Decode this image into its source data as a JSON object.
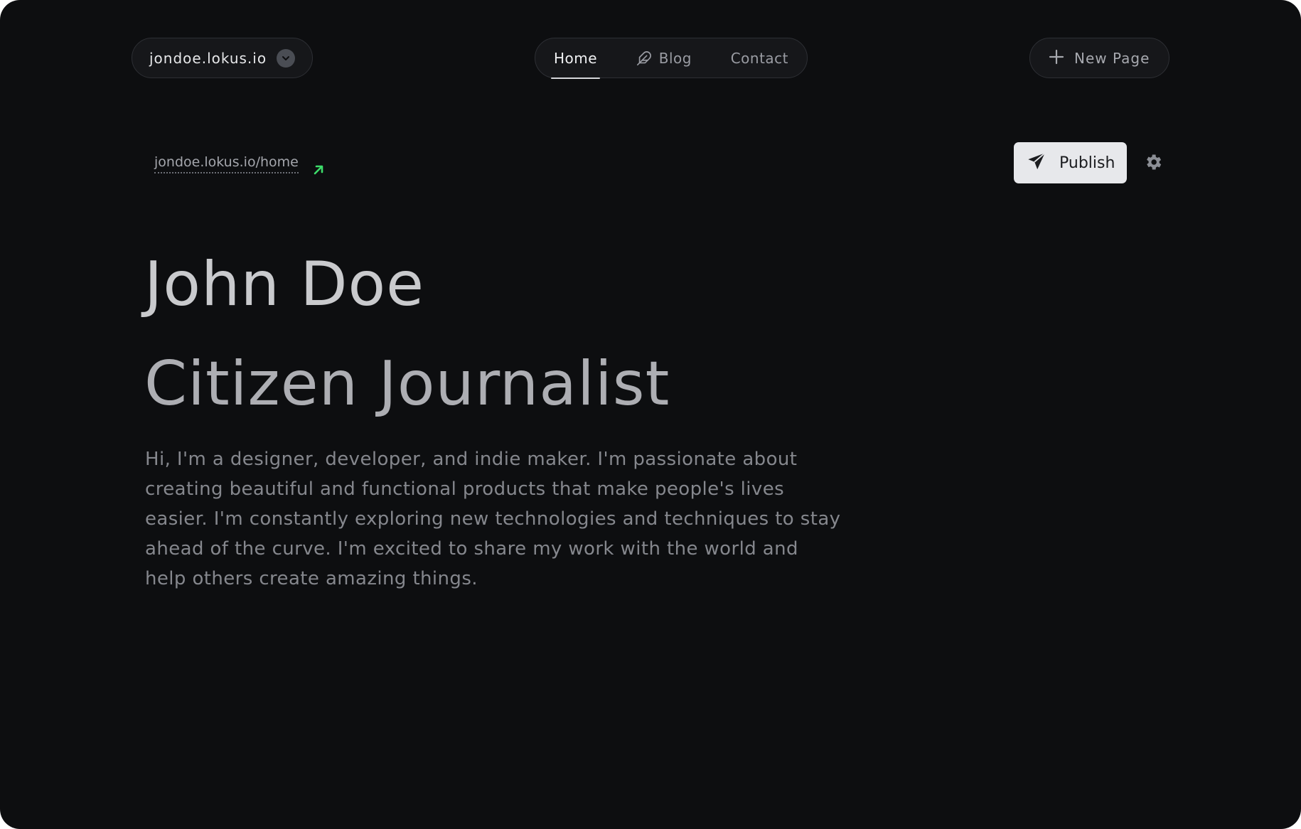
{
  "header": {
    "site_switcher": {
      "site": "jondoe.lokus.io",
      "icon": "chevron-down-icon"
    },
    "nav": {
      "tabs": [
        {
          "label": "Home",
          "active": true
        },
        {
          "label": "Blog",
          "icon": "feather-icon"
        },
        {
          "label": "Contact"
        }
      ]
    },
    "new_page": {
      "label": "New Page",
      "icon": "plus-icon"
    }
  },
  "toolbar": {
    "page_url": "jondoe.lokus.io/home",
    "open_icon": "arrow-up-right-icon",
    "publish_label": "Publish",
    "publish_icon": "send-icon",
    "settings_icon": "gear-icon"
  },
  "content": {
    "name": "John Doe",
    "role": "Citizen Journalist",
    "bio": "Hi, I'm a designer, developer, and indie maker. I'm passionate about creating beautiful and functional products that make people's lives easier. I'm constantly exploring new technologies and techniques to stay ahead of the curve. I'm excited to share my work with the world and help others create amazing things."
  },
  "colors": {
    "background": "#0d0e10",
    "accent_green": "#3ddc6a",
    "publish_bg": "#e7e8eb"
  }
}
